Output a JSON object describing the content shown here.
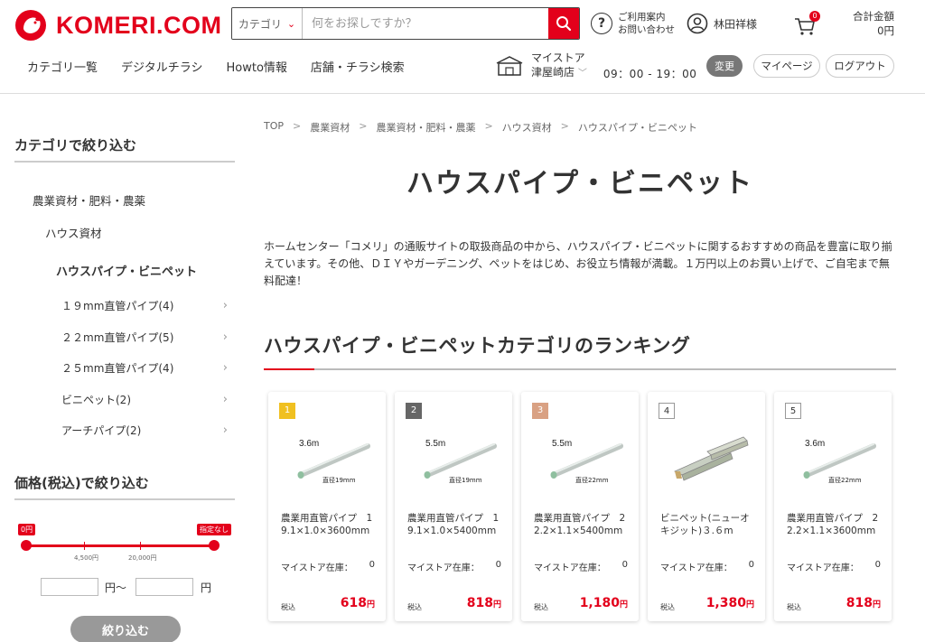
{
  "header": {
    "logo_text": "KOMERI.COM",
    "search_category": "カテゴリ",
    "search_placeholder": "何をお探しですか？",
    "help_line1": "ご利用案内",
    "help_line2": "お問い合わせ",
    "user_name": "林田祥様",
    "cart_count": "0",
    "total_label": "合計金額",
    "total_value": "0円",
    "nav": [
      "カテゴリ一覧",
      "デジタルチラシ",
      "Howto情報",
      "店舗・チラシ検索"
    ],
    "store_label": "マイストア",
    "store_name": "津屋崎店",
    "store_hours": "09：00 - 19：00",
    "change_label": "変更",
    "mypage_label": "マイページ",
    "logout_label": "ログアウト"
  },
  "sidebar": {
    "category_title": "カテゴリで絞り込む",
    "level1": "農業資材・肥料・農薬",
    "level2": "ハウス資材",
    "level3": "ハウスパイプ・ビニペット",
    "subs": [
      "１９mm直管パイプ(4)",
      "２２mm直管パイプ(5)",
      "２５mm直管パイプ(4)",
      "ビニペット(2)",
      "アーチパイプ(2)"
    ],
    "price_title": "価格(税込)で絞り込む",
    "slider_min_label": "0円",
    "slider_max_label": "指定なし",
    "tick1": "4,500円",
    "tick2": "20,000円",
    "unit_from": "円〜",
    "unit_to": "円",
    "filter_button": "絞り込む"
  },
  "main": {
    "breadcrumb": [
      "TOP",
      "農業資材",
      "農業資材・肥料・農薬",
      "ハウス資材",
      "ハウスパイプ・ビニペット"
    ],
    "page_title": "ハウスパイプ・ビニペット",
    "description": "ホームセンター「コメリ」の通販サイトの取扱商品の中から、ハウスパイプ・ビニペットに関するおすすめの商品を豊富に取り揃えています。その他、ＤＩＹやガーデニング、ペットをはじめ、お役立ち情報が満載。１万円以上のお買い上げで、ご自宅まで無料配達！",
    "ranking_title": "ハウスパイプ・ビニペットカテゴリのランキング",
    "stock_label": "マイストア在庫：",
    "tax_label": "税込",
    "products": [
      {
        "rank": "1",
        "badge_color": "#f0c020",
        "img_len": "3.6m",
        "img_dia": "直径19mm",
        "type": "pipe",
        "name": "農業用直管パイプ　19.1×1.0×3600mm",
        "stock": "0",
        "price": "618",
        "yen": "円"
      },
      {
        "rank": "2",
        "badge_color": "#666666",
        "img_len": "5.5m",
        "img_dia": "直径19mm",
        "type": "pipe",
        "name": "農業用直管パイプ　19.1×1.0×5400mm",
        "stock": "0",
        "price": "818",
        "yen": "円"
      },
      {
        "rank": "3",
        "badge_color": "#d9a183",
        "img_len": "5.5m",
        "img_dia": "直径22mm",
        "type": "pipe",
        "name": "農業用直管パイプ　22.2×1.1×5400mm",
        "stock": "0",
        "price": "1,180",
        "yen": "円"
      },
      {
        "rank": "4",
        "badge_color": "#ffffff",
        "img_len": "",
        "img_dia": "",
        "type": "channel",
        "name": "ビニペット(ニューオキジット)３.６m",
        "stock": "0",
        "price": "1,380",
        "yen": "円"
      },
      {
        "rank": "5",
        "badge_color": "#ffffff",
        "img_len": "3.6m",
        "img_dia": "直径22mm",
        "type": "pipe",
        "name": "農業用直管パイプ　22.2×1.1×3600mm",
        "stock": "0",
        "price": "818",
        "yen": "円"
      }
    ]
  },
  "colors": {
    "brand": "#e3001b"
  }
}
